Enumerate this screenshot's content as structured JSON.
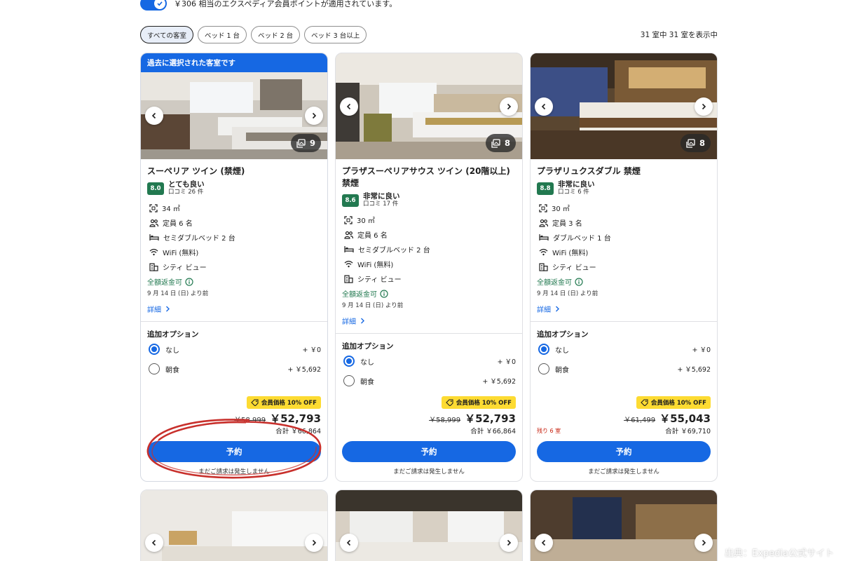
{
  "points_banner": {
    "text": "￥306 相当のエクスペディア会員ポイントが適用されています。"
  },
  "filters": {
    "chips": [
      "すべての客室",
      "ベッド 1 台",
      "ベッド 2 台",
      "ベッド 3 台以上"
    ],
    "active": "すべての客室",
    "count_text": "31 室中 31 室を表示中"
  },
  "colors": {
    "accent": "#1668e3",
    "rating_green": "#227950",
    "badge_yellow": "#fddb32",
    "alert_red": "#c51906"
  },
  "common": {
    "options_title": "追加オプション",
    "opt_none": "なし",
    "opt_none_price": "+ ￥0",
    "opt_breakfast": "朝食",
    "opt_breakfast_price": "+ ￥5,692",
    "refund": "全額返金可",
    "refund_date": "9 月 14 日 (日) より前",
    "details": "詳細",
    "badge": "会員価格 10% OFF",
    "reserve": "予約",
    "no_charge": "まだご請求は発生しません"
  },
  "cards": [
    {
      "selected_banner": "過去に選択された客室です",
      "photo_count": "9",
      "name": "スーペリア ツイン (禁煙)",
      "score": "8.0",
      "rating_label": "とても良い",
      "reviews": "口コミ 26 件",
      "area": "34 ㎡",
      "capacity": "定員 6 名",
      "bed": "セミダブルベッド 2 台",
      "wifi": "WiFi (無料)",
      "view": "シティ ビュー",
      "old_price": "￥58,999",
      "new_price": "￥52,793",
      "total": "合計 ￥66,864",
      "remaining": ""
    },
    {
      "selected_banner": "",
      "photo_count": "8",
      "name": "プラザスーペリアサウス ツイン (20階以上) 禁煙",
      "score": "8.6",
      "rating_label": "非常に良い",
      "reviews": "口コミ 17 件",
      "area": "30 ㎡",
      "capacity": "定員 6 名",
      "bed": "セミダブルベッド 2 台",
      "wifi": "WiFi (無料)",
      "view": "シティ ビュー",
      "old_price": "￥58,999",
      "new_price": "￥52,793",
      "total": "合計 ￥66,864",
      "remaining": ""
    },
    {
      "selected_banner": "",
      "photo_count": "8",
      "name": "プラザリュクスダブル 禁煙",
      "score": "8.8",
      "rating_label": "非常に良い",
      "reviews": "口コミ 6 件",
      "area": "30 ㎡",
      "capacity": "定員 3 名",
      "bed": "ダブルベッド 1 台",
      "wifi": "WiFi (無料)",
      "view": "シティ ビュー",
      "old_price": "￥61,499",
      "new_price": "￥55,043",
      "total": "合計 ￥69,710",
      "remaining": "残り 6 室"
    }
  ],
  "credit": "出典：Expedia公式サイト"
}
